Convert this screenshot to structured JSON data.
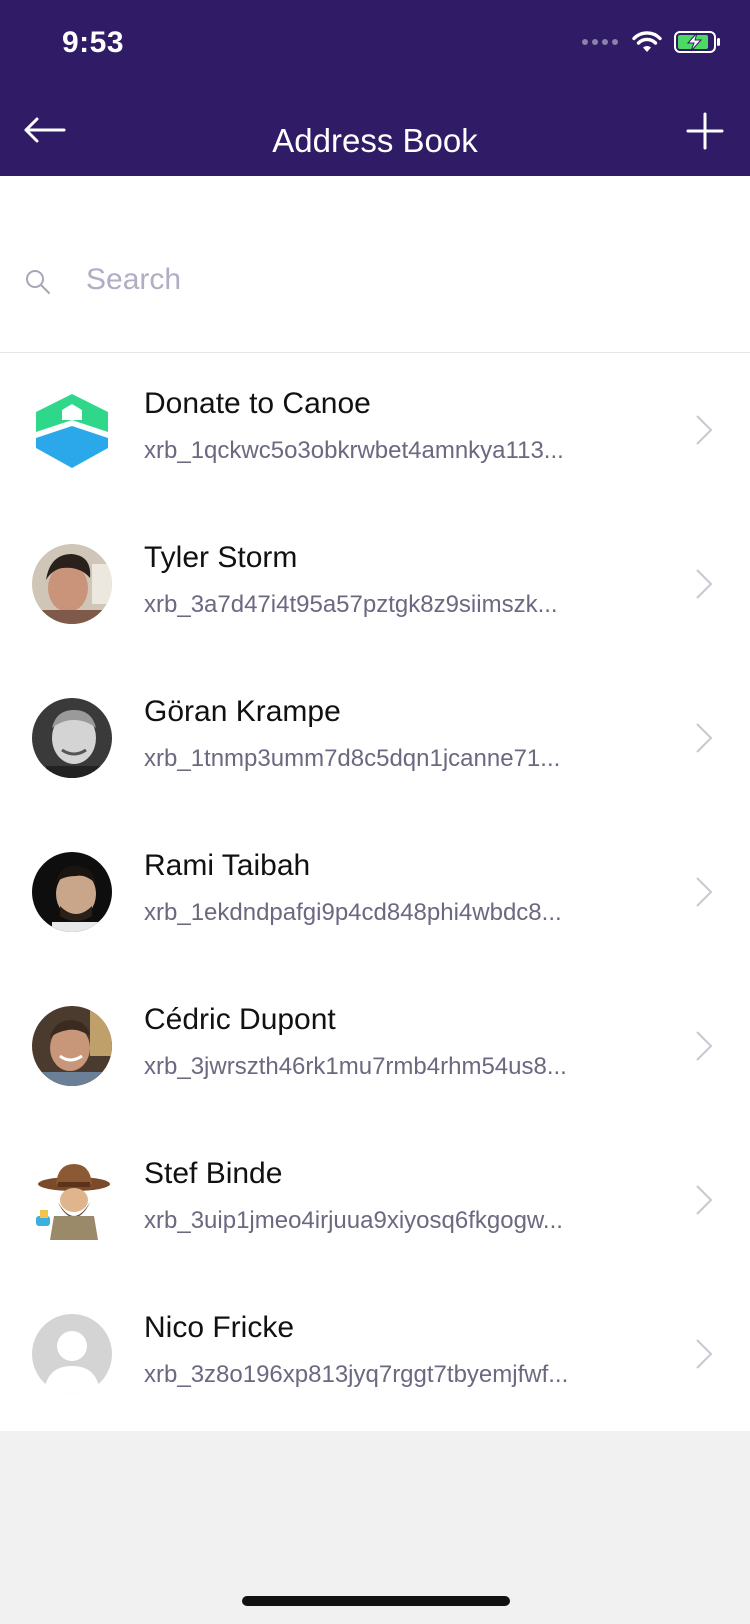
{
  "status_bar": {
    "time": "9:53"
  },
  "header": {
    "title": "Address Book"
  },
  "search": {
    "placeholder": "Search"
  },
  "contacts": [
    {
      "name": "Donate to Canoe",
      "address": "xrb_1qckwc5o3obkrwbet4amnkya113..."
    },
    {
      "name": "Tyler Storm",
      "address": "xrb_3a7d47i4t95a57pztgk8z9siimszk..."
    },
    {
      "name": "Göran Krampe",
      "address": "xrb_1tnmp3umm7d8c5dqn1jcanne71..."
    },
    {
      "name": "Rami Taibah",
      "address": "xrb_1ekdndpafgi9p4cd848phi4wbdc8..."
    },
    {
      "name": "Cédric Dupont",
      "address": "xrb_3jwrszth46rk1mu7rmb4rhm54us8..."
    },
    {
      "name": "Stef Binde",
      "address": "xrb_3uip1jmeo4irjuua9xiyosq6fkgogw..."
    },
    {
      "name": "Nico Fricke",
      "address": "xrb_3z8o196xp813jyq7rggt7tbyemjfwf..."
    }
  ],
  "colors": {
    "header_bg": "#2f1b66",
    "background": "#f1f1f1",
    "battery_green": "#4cd964"
  }
}
